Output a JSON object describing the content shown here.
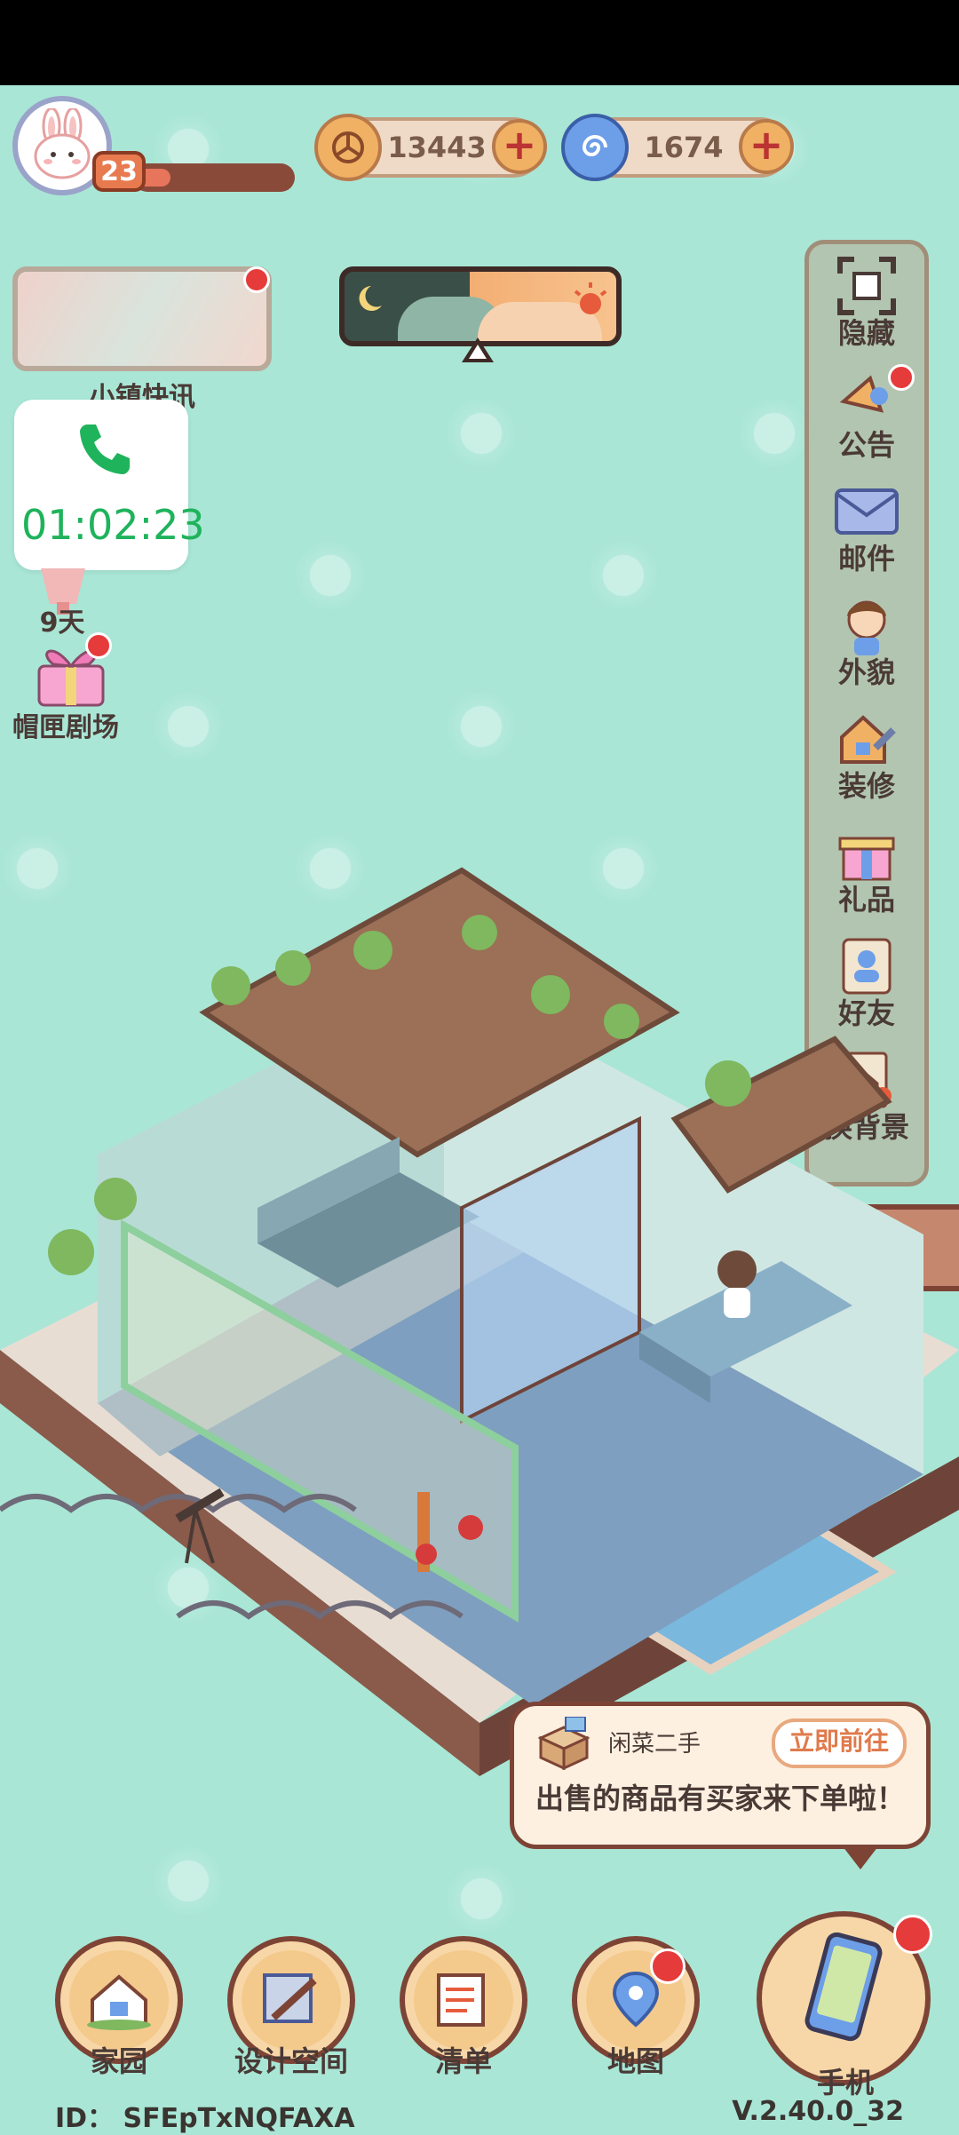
{
  "colors": {
    "background": "#a9e6d6",
    "accent": "#e07a4c",
    "badge": "#e63b3b",
    "call_green": "#1fb35b"
  },
  "player": {
    "level": "23",
    "xp_progress": 0.22
  },
  "currencies": [
    {
      "icon": "coin-icon",
      "value": "13443"
    },
    {
      "icon": "swirl-gem-icon",
      "value": "1674"
    }
  ],
  "left": {
    "news_label": "小镇快讯",
    "event_days": "9天",
    "theater_label": "帽匣剧场"
  },
  "call": {
    "time": "01:02:23"
  },
  "menu": [
    {
      "label": "隐藏",
      "icon": "hide-icon"
    },
    {
      "label": "公告",
      "icon": "announcement-icon"
    },
    {
      "label": "邮件",
      "icon": "mail-icon"
    },
    {
      "label": "外貌",
      "icon": "appearance-icon"
    },
    {
      "label": "装修",
      "icon": "decorate-icon"
    },
    {
      "label": "礼品",
      "icon": "gift-icon"
    },
    {
      "label": "好友",
      "icon": "friends-icon"
    },
    {
      "label": "换背景",
      "icon": "background-icon"
    }
  ],
  "notification": {
    "title": "闲菜二手",
    "button": "立即前往",
    "message": "出售的商品有买家来下单啦！"
  },
  "nav": [
    {
      "label": "家园",
      "icon": "home-icon"
    },
    {
      "label": "设计空间",
      "icon": "design-icon"
    },
    {
      "label": "清单",
      "icon": "list-icon"
    },
    {
      "label": "地图",
      "icon": "map-icon"
    },
    {
      "label": "手机",
      "icon": "phone-icon"
    }
  ],
  "footer": {
    "id": "ID：  SFEpTxNQFAXA",
    "version": "V.2.40.0_32"
  }
}
